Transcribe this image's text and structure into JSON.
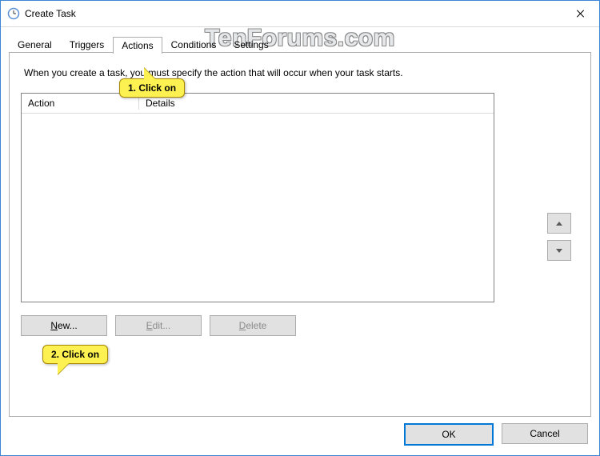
{
  "titlebar": {
    "title": "Create Task"
  },
  "watermark": "TenForums.com",
  "tabs": {
    "general": "General",
    "triggers": "Triggers",
    "actions": "Actions",
    "conditions": "Conditions",
    "settings": "Settings"
  },
  "panel": {
    "instruction": "When you create a task, you must specify the action that will occur when your task starts.",
    "columns": {
      "action": "Action",
      "details": "Details"
    },
    "buttons": {
      "new_prefix": "N",
      "new_rest": "ew...",
      "edit_prefix": "E",
      "edit_rest": "dit...",
      "delete_prefix": "D",
      "delete_rest": "elete"
    }
  },
  "footer": {
    "ok": "OK",
    "cancel": "Cancel"
  },
  "callouts": {
    "c1": "1. Click on",
    "c2": "2. Click on"
  }
}
